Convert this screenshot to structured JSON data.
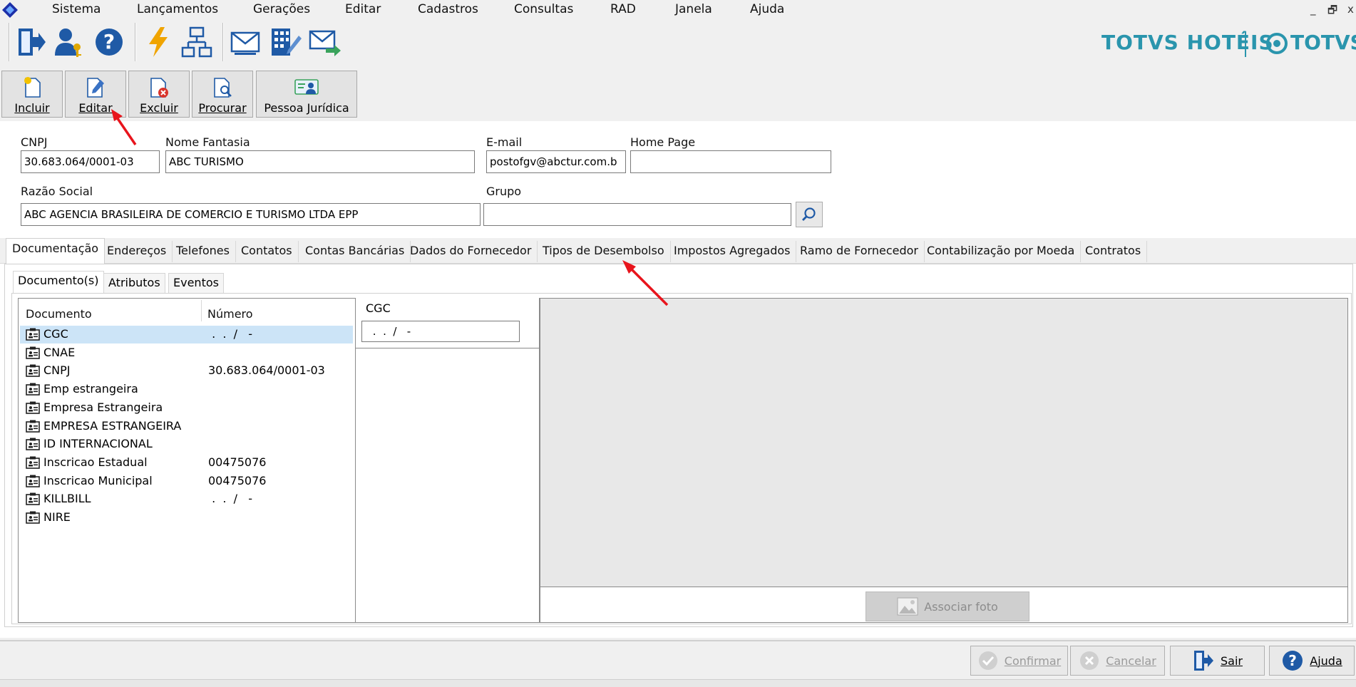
{
  "menu": {
    "items": [
      "Sistema",
      "Lançamentos",
      "Gerações",
      "Editar",
      "Cadastros",
      "Consultas",
      "RAD",
      "Janela",
      "Ajuda"
    ]
  },
  "window_controls": {
    "minimize": "_",
    "restore": "🗗",
    "close": "x"
  },
  "brand": {
    "product": "TOTVS HOTÉIS",
    "company": "TOTVS",
    "color": "#2a95ad"
  },
  "actions": {
    "incluir": "Incluir",
    "editar": "Editar",
    "excluir": "Excluir",
    "procurar": "Procurar",
    "pessoa_juridica": "Pessoa Jurídica"
  },
  "form": {
    "cnpj_label": "CNPJ",
    "cnpj_value": "30.683.064/0001-03",
    "nome_fantasia_label": "Nome Fantasia",
    "nome_fantasia_value": "ABC TURISMO",
    "email_label": "E-mail",
    "email_value": "postofgv@abctur.com.b",
    "home_page_label": "Home Page",
    "home_page_value": "",
    "razao_social_label": "Razão Social",
    "razao_social_value": "ABC AGENCIA BRASILEIRA DE COMERCIO E TURISMO LTDA EPP",
    "grupo_label": "Grupo",
    "grupo_value": ""
  },
  "tabs": [
    "Documentação",
    "Endereços",
    "Telefones",
    "Contatos",
    "Contas Bancárias",
    "Dados do Fornecedor",
    "Tipos de Desembolso",
    "Impostos Agregados",
    "Ramo de Fornecedor",
    "Contabilização por Moeda",
    "Contratos"
  ],
  "subtabs": [
    "Documento(s)",
    "Atributos",
    "Eventos"
  ],
  "grid": {
    "col_documento": "Documento",
    "col_numero": "Número",
    "rows": [
      {
        "doc": "CGC",
        "num": " .  .  /   -"
      },
      {
        "doc": "CNAE",
        "num": ""
      },
      {
        "doc": "CNPJ",
        "num": "30.683.064/0001-03"
      },
      {
        "doc": "Emp estrangeira",
        "num": ""
      },
      {
        "doc": "Empresa Estrangeira",
        "num": ""
      },
      {
        "doc": "EMPRESA ESTRANGEIRA",
        "num": ""
      },
      {
        "doc": "ID INTERNACIONAL",
        "num": ""
      },
      {
        "doc": "Inscricao Estadual",
        "num": "00475076"
      },
      {
        "doc": "Inscricao Municipal",
        "num": "00475076"
      },
      {
        "doc": "KILLBILL",
        "num": " .  .  /   -"
      },
      {
        "doc": "NIRE",
        "num": ""
      }
    ]
  },
  "detail": {
    "label": "CGC",
    "value": " .  .  /   -"
  },
  "photo": {
    "associar_label": "Associar foto"
  },
  "bottom": {
    "confirmar": "Confirmar",
    "cancelar": "Cancelar",
    "sair": "Sair",
    "ajuda": "Ajuda"
  }
}
